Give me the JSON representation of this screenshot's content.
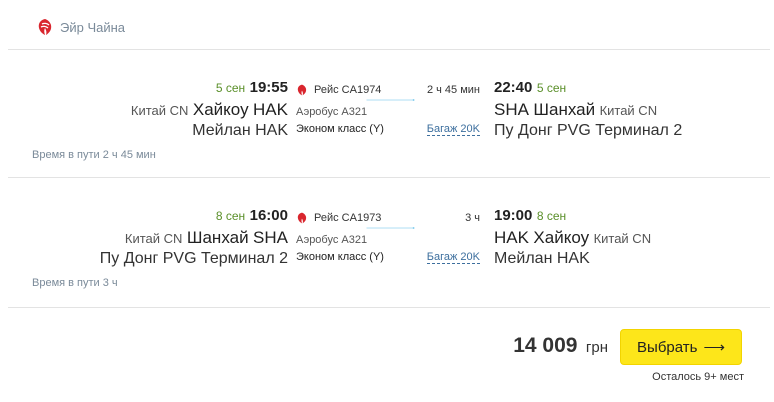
{
  "airline": {
    "name": "Эйр Чайна",
    "logo_icon": "air-china-logo-icon",
    "brand_color": "#d9262e"
  },
  "legs": [
    {
      "departure": {
        "date": "5 сен",
        "time": "19:55",
        "country": "Китай CN",
        "city": "Хайкоу",
        "code": "HAK",
        "airport": "Мейлан HAK"
      },
      "flight": {
        "number": "Рейс CA1974",
        "duration": "2 ч 45 мин",
        "aircraft": "Аэробус А321",
        "cabin": "Эконом класс (Y)",
        "baggage": "Багаж 20K"
      },
      "arrival": {
        "date": "5 сен",
        "time": "22:40",
        "country": "Китай CN",
        "city": "Шанхай",
        "code": "SHA",
        "airport": "Пу Донг PVG Терминал 2"
      },
      "travel_time": "Время в пути 2 ч 45 мин"
    },
    {
      "departure": {
        "date": "8 сен",
        "time": "16:00",
        "country": "Китай CN",
        "city": "Шанхай",
        "code": "SHA",
        "airport": "Пу Донг PVG Терминал 2"
      },
      "flight": {
        "number": "Рейс CA1973",
        "duration": "3 ч",
        "aircraft": "Аэробус А321",
        "cabin": "Эконом класс (Y)",
        "baggage": "Багаж 20K"
      },
      "arrival": {
        "date": "8 сен",
        "time": "19:00",
        "country": "Китай CN",
        "city": "Хайкоу",
        "code": "HAK",
        "airport": "Мейлан HAK"
      },
      "travel_time": "Время в пути 3 ч"
    }
  ],
  "price": {
    "amount": "14 009",
    "currency": "грн"
  },
  "select_button": {
    "label": "Выбрать",
    "arrow": "⟶"
  },
  "seats_left": "Осталось 9+ мест",
  "colors": {
    "accent_blue": "#29a8e0",
    "date_green": "#5a8f29",
    "button_yellow": "#fde61a",
    "link_blue": "#3d6f9e"
  }
}
